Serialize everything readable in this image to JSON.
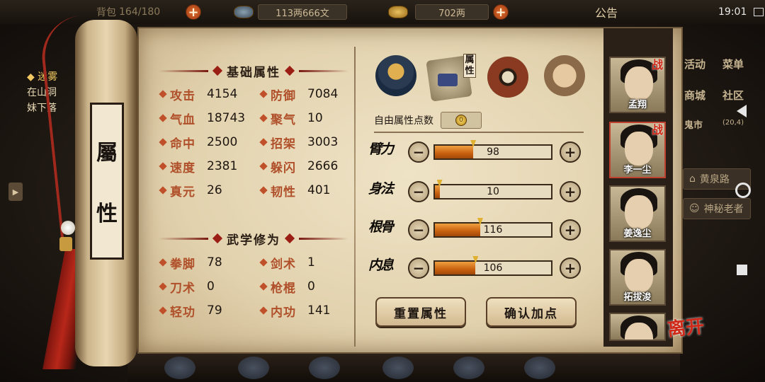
{
  "topbar": {
    "bag_label": "背包",
    "bag_count": "164/180",
    "silver": "113两666文",
    "gold": "702两",
    "notice": "公告",
    "clock": "19:01"
  },
  "mission": {
    "title": "迷雾",
    "line1": "在山洞",
    "line2": "妹下落"
  },
  "scroll": {
    "char1": "屬",
    "char2": "性"
  },
  "basic": {
    "title": "基础属性",
    "stats": [
      {
        "label": "攻击",
        "value": "4154"
      },
      {
        "label": "防御",
        "value": "7084"
      },
      {
        "label": "气血",
        "value": "18743"
      },
      {
        "label": "聚气",
        "value": "10"
      },
      {
        "label": "命中",
        "value": "2500"
      },
      {
        "label": "招架",
        "value": "3003"
      },
      {
        "label": "速度",
        "value": "2381"
      },
      {
        "label": "躲闪",
        "value": "2666"
      },
      {
        "label": "真元",
        "value": "26"
      },
      {
        "label": "韧性",
        "value": "401"
      }
    ]
  },
  "martial": {
    "title": "武学修为",
    "stats": [
      {
        "label": "拳脚",
        "value": "78"
      },
      {
        "label": "剑术",
        "value": "1"
      },
      {
        "label": "刀术",
        "value": "0"
      },
      {
        "label": "枪棍",
        "value": "0"
      },
      {
        "label": "轻功",
        "value": "79"
      },
      {
        "label": "内功",
        "value": "141"
      }
    ]
  },
  "tabs": {
    "attr_label": "属性",
    "icons": [
      "hat-icon",
      "scroll-icon",
      "taiji-icon",
      "fist-icon"
    ]
  },
  "free_points": {
    "label": "自由属性点数",
    "value": "0"
  },
  "attributes": [
    {
      "name": "臂力",
      "value": "98",
      "fill": 0.33
    },
    {
      "name": "身法",
      "value": "10",
      "fill": 0.04
    },
    {
      "name": "根骨",
      "value": "116",
      "fill": 0.39
    },
    {
      "name": "内息",
      "value": "106",
      "fill": 0.35
    }
  ],
  "buttons": {
    "reset": "重置属性",
    "confirm": "确认加点"
  },
  "roster": [
    {
      "name": "孟翔",
      "tag": "战"
    },
    {
      "name": "李一尘",
      "tag": "战"
    },
    {
      "name": "姜逸尘",
      "tag": ""
    },
    {
      "name": "拓拔浚",
      "tag": ""
    },
    {
      "name": "",
      "tag": ""
    }
  ],
  "side_menu": {
    "activity": "活动",
    "menu": "菜单",
    "shop": "商城",
    "community": "社区",
    "ghost_market": "鬼市",
    "coords": "(20,4)",
    "huangquan": "黄泉路",
    "mystery_elder": "神秘老者"
  },
  "leave": "离开"
}
